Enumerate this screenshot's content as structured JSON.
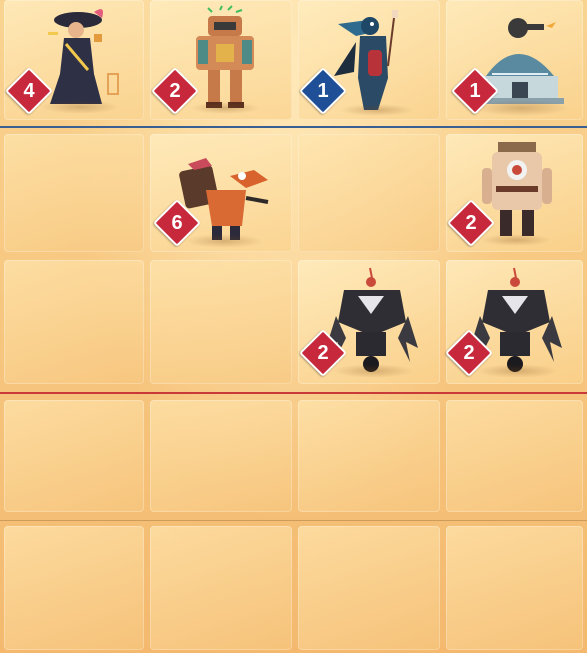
{
  "colors": {
    "enemy_badge": "#c8283c",
    "ally_badge": "#1f4f97",
    "tile": "#f9d897",
    "divider_blue": "#3a5f92",
    "divider_red": "#c83a3a"
  },
  "units": [
    {
      "name": "pirate-lady",
      "count": "4",
      "team": "enemy"
    },
    {
      "name": "copper-robot",
      "count": "2",
      "team": "enemy"
    },
    {
      "name": "raven-mage",
      "count": "1",
      "team": "ally"
    },
    {
      "name": "domed-turret-fortress",
      "count": "1",
      "team": "enemy"
    },
    {
      "name": "fox-backpack-soldier",
      "count": "6",
      "team": "enemy"
    },
    {
      "name": "lantern-robot",
      "count": "2",
      "team": "enemy"
    },
    {
      "name": "clawed-walker-left",
      "count": "2",
      "team": "enemy"
    },
    {
      "name": "clawed-walker-right",
      "count": "2",
      "team": "enemy"
    }
  ]
}
